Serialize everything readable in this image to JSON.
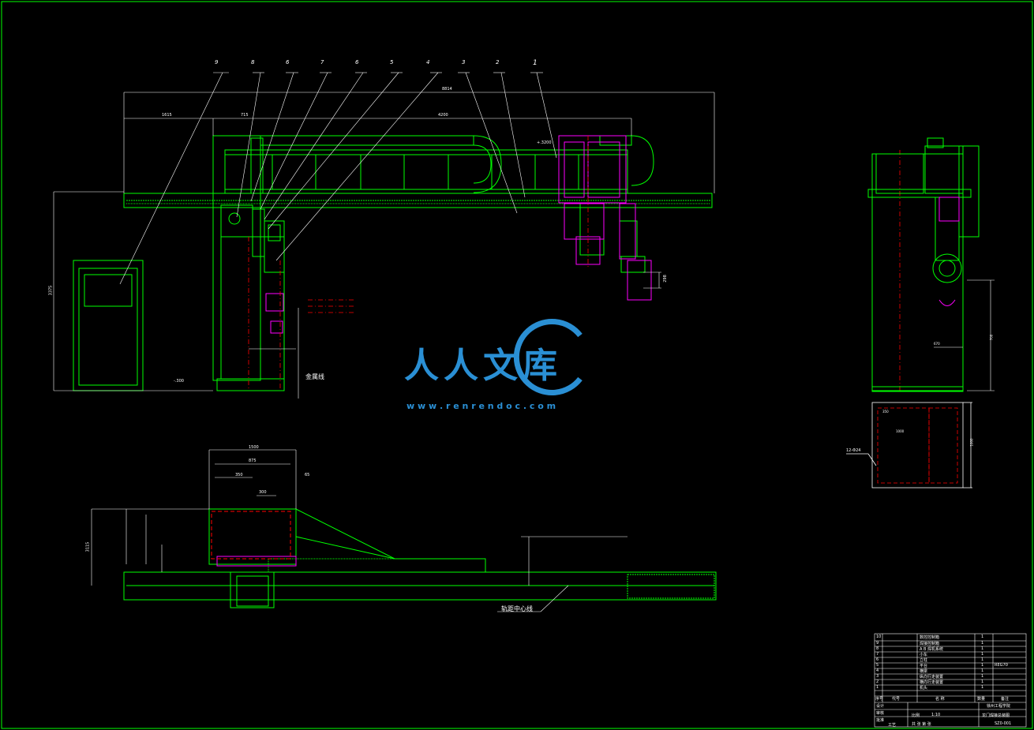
{
  "callouts": [
    "9",
    "8",
    "6",
    "7",
    "6",
    "5",
    "4",
    "3",
    "2",
    "1"
  ],
  "labels": {
    "metal_line": "金属线",
    "rail_center_line": "轨距中心线"
  },
  "dimensions": {
    "overall_top": "8814",
    "span_left": "1615",
    "span_mid": "715",
    "span_right": "4200",
    "height_left": "3375",
    "floor_level": "-.300",
    "elevation_top": "+.3200",
    "small_298": "298",
    "bottom_top_width": "1500",
    "bottom_inner": "875",
    "bottom_a": "350",
    "bottom_b": "300",
    "bottom_c": "65",
    "bottom_left_height": "3115",
    "side_base_label": "12-Φ24",
    "side_w1": "350",
    "side_w2": "1000",
    "side_h1": "700",
    "side_h2": "670",
    "side_h3": "1000"
  },
  "title_block": {
    "rows": [
      {
        "no": "10",
        "code": "",
        "name": "数控控制箱",
        "qty": "1",
        "note": ""
      },
      {
        "no": "9",
        "code": "",
        "name": "焊接控制箱",
        "qty": "1",
        "note": ""
      },
      {
        "no": "8",
        "code": "",
        "name": "A  B  焊机系统",
        "qty": "1",
        "note": ""
      },
      {
        "no": "7",
        "code": "",
        "name": "小车",
        "qty": "1",
        "note": ""
      },
      {
        "no": "6",
        "code": "",
        "name": "立柱",
        "qty": "1",
        "note": ""
      },
      {
        "no": "5",
        "code": "",
        "name": "平台",
        "qty": "1",
        "note": "REG70"
      },
      {
        "no": "4",
        "code": "",
        "name": "横梁",
        "qty": "1",
        "note": ""
      },
      {
        "no": "3",
        "code": "",
        "name": "纵向行走装置",
        "qty": "1",
        "note": ""
      },
      {
        "no": "2",
        "code": "",
        "name": "横向行走装置",
        "qty": "1",
        "note": ""
      },
      {
        "no": "1",
        "code": "",
        "name": "机头",
        "qty": "1",
        "note": ""
      }
    ],
    "header": {
      "no": "序号",
      "code": "代号",
      "name": "名    称",
      "qty": "数量",
      "note": "备注"
    },
    "school": "徐州工程学院",
    "scale_label": "比例",
    "scale_value": "1:10",
    "drawing_title": "龙门焊接总装图",
    "drawing_no": "SZ0-001",
    "sheet_label": "共   张  第   张",
    "design": "设计",
    "check": "审核",
    "approve": "批准",
    "process": "工艺"
  },
  "watermark": {
    "chars": "人人文库",
    "url": "w w w . r e n r e n d o c . c o m"
  },
  "colors": {
    "line": "#00ff00",
    "dim": "#ffffff",
    "center": "#ff0000",
    "ghost": "#ff00ff",
    "accent": "#2a8fd4"
  }
}
